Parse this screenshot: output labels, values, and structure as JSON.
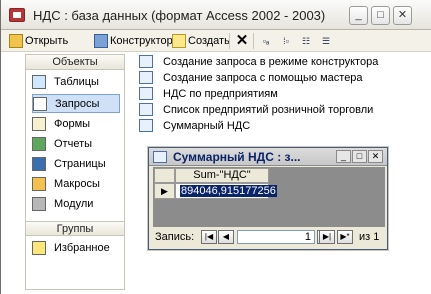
{
  "window": {
    "title": "НДС : база данных (формат Access 2002 - 2003)"
  },
  "toolbar": {
    "open_label": "Открыть",
    "design_label": "Конструктор",
    "new_label": "Создать",
    "delete_icon": "close-icon",
    "view_icons": [
      "small-icons-icon",
      "list-icon",
      "details-icon",
      "large-icons-icon"
    ]
  },
  "objects_bar": {
    "header": "Объекты",
    "items": [
      {
        "label": "Таблицы",
        "icon": "table-icon"
      },
      {
        "label": "Запросы",
        "icon": "query-icon",
        "selected": true
      },
      {
        "label": "Формы",
        "icon": "form-icon"
      },
      {
        "label": "Отчеты",
        "icon": "report-icon"
      },
      {
        "label": "Страницы",
        "icon": "page-icon"
      },
      {
        "label": "Макросы",
        "icon": "macro-icon"
      },
      {
        "label": "Модули",
        "icon": "module-icon"
      }
    ],
    "groups_header": "Группы",
    "groups": [
      {
        "label": "Избранное",
        "icon": "favorites-icon"
      }
    ]
  },
  "queries": [
    "Создание запроса в режиме конструктора",
    "Создание запроса с помощью мастера",
    "НДС по предприятиям",
    "Список предприятий розничной торговли",
    "Суммарный НДС"
  ],
  "query_window": {
    "title": "Суммарный НДС : з...",
    "column_header": "Sum-\"НДС\"",
    "cell_value": "894046,915177256",
    "nav_label": "Запись:",
    "record_number": "1",
    "of_label": "из  1"
  }
}
